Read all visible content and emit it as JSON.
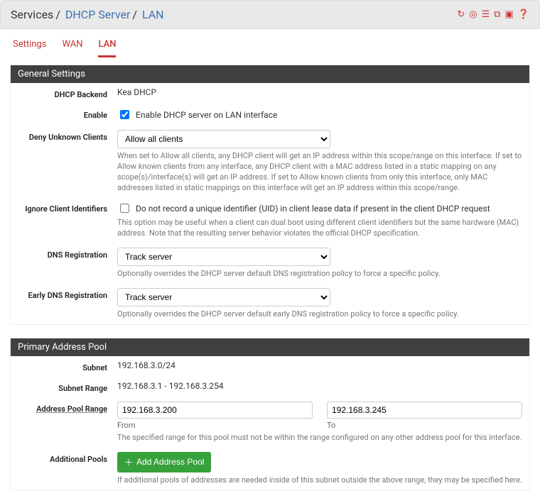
{
  "breadcrumb": {
    "root": "Services",
    "mid": "DHCP Server",
    "leaf": "LAN"
  },
  "tabs": {
    "settings": "Settings",
    "wan": "WAN",
    "lan": "LAN"
  },
  "sections": {
    "general": "General Settings",
    "pool": "Primary Address Pool"
  },
  "labels": {
    "backend": "DHCP Backend",
    "enable": "Enable",
    "deny_unknown": "Deny Unknown Clients",
    "ignore_cid": "Ignore Client Identifiers",
    "dns_reg": "DNS Registration",
    "early_dns_reg": "Early DNS Registration",
    "subnet": "Subnet",
    "subnet_range": "Subnet Range",
    "addr_pool_range": "Address Pool Range",
    "additional_pools": "Additional Pools",
    "from": "From",
    "to": "To"
  },
  "values": {
    "backend": "Kea DHCP",
    "enable_cb_label": "Enable DHCP server on LAN interface",
    "deny_unknown_selected": "Allow all clients",
    "ignore_cid_label": "Do not record a unique identifier (UID) in client lease data if present in the client DHCP request",
    "dns_reg_selected": "Track server",
    "early_dns_reg_selected": "Track server",
    "subnet": "192.168.3.0/24",
    "subnet_range": "192.168.3.1 - 192.168.3.254",
    "pool_from": "192.168.3.200",
    "pool_to": "192.168.3.245",
    "add_pool_btn": "Add Address Pool"
  },
  "help": {
    "deny_unknown": "When set to Allow all clients, any DHCP client will get an IP address within this scope/range on this interface. If set to Allow known clients from any interface, any DHCP client with a MAC address listed in a static mapping on any scope(s)/interface(s) will get an IP address. If set to Allow known clients from only this interface, only MAC addresses listed in static mappings on this interface will get an IP address within this scope/range.",
    "ignore_cid": "This option may be useful when a client can dual boot using different client identifiers but the same hardware (MAC) address. Note that the resulting server behavior violates the official DHCP specification.",
    "dns_reg": "Optionally overrides the DHCP server default DNS registration policy to force a specific policy.",
    "early_dns_reg": "Optionally overrides the DHCP server default early DNS registration policy to force a specific policy.",
    "pool_range": "The specified range for this pool must not be within the range configured on any other address pool for this interface.",
    "additional_pools": "If additional pools of addresses are needed inside of this subnet outside the above range, they may be specified here."
  }
}
